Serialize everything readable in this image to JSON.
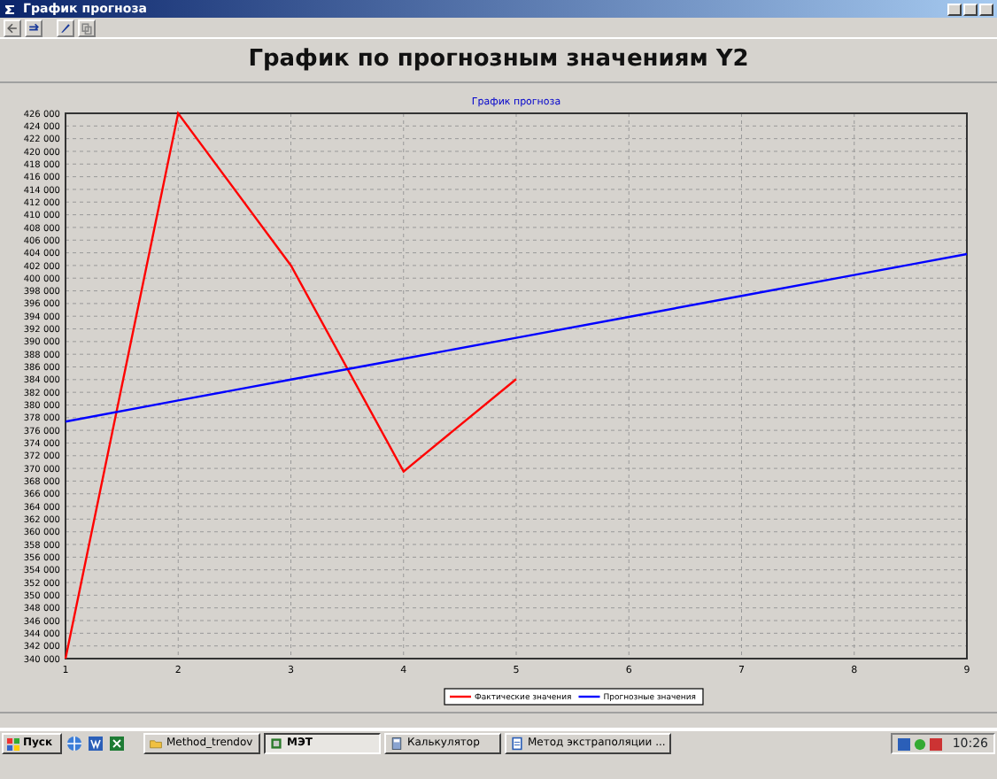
{
  "window": {
    "title": "График прогноза"
  },
  "toolbar": {
    "buttons": [
      {
        "kind": "back"
      },
      {
        "kind": "forward"
      },
      {
        "kind": "edit"
      },
      {
        "kind": "copy"
      }
    ]
  },
  "heading": "График по прогнозным значениям Y2",
  "chart_data": {
    "type": "line",
    "title": "График прогноза",
    "grid": true,
    "legend": true,
    "x": [
      1,
      2,
      3,
      4,
      5,
      6,
      7,
      8,
      9
    ],
    "xlim": [
      1,
      9
    ],
    "ylim": [
      340000,
      426000
    ],
    "xticks": [
      1,
      2,
      3,
      4,
      5,
      6,
      7,
      8,
      9
    ],
    "yticks": [
      {
        "value": 340000,
        "label": "340 000"
      },
      {
        "value": 342000,
        "label": "342 000"
      },
      {
        "value": 344000,
        "label": "344 000"
      },
      {
        "value": 346000,
        "label": "346 000"
      },
      {
        "value": 348000,
        "label": "348 000"
      },
      {
        "value": 350000,
        "label": "350 000"
      },
      {
        "value": 352000,
        "label": "352 000"
      },
      {
        "value": 354000,
        "label": "354 000"
      },
      {
        "value": 356000,
        "label": "356 000"
      },
      {
        "value": 358000,
        "label": "358 000"
      },
      {
        "value": 360000,
        "label": "360 000"
      },
      {
        "value": 362000,
        "label": "362 000"
      },
      {
        "value": 364000,
        "label": "364 000"
      },
      {
        "value": 366000,
        "label": "366 000"
      },
      {
        "value": 368000,
        "label": "368 000"
      },
      {
        "value": 370000,
        "label": "370 000"
      },
      {
        "value": 372000,
        "label": "372 000"
      },
      {
        "value": 374000,
        "label": "374 000"
      },
      {
        "value": 376000,
        "label": "376 000"
      },
      {
        "value": 378000,
        "label": "378 000"
      },
      {
        "value": 380000,
        "label": "380 000"
      },
      {
        "value": 382000,
        "label": "382 000"
      },
      {
        "value": 384000,
        "label": "384 000"
      },
      {
        "value": 386000,
        "label": "386 000"
      },
      {
        "value": 388000,
        "label": "388 000"
      },
      {
        "value": 390000,
        "label": "390 000"
      },
      {
        "value": 392000,
        "label": "392 000"
      },
      {
        "value": 394000,
        "label": "394 000"
      },
      {
        "value": 396000,
        "label": "396 000"
      },
      {
        "value": 398000,
        "label": "398 000"
      },
      {
        "value": 400000,
        "label": "400 000"
      },
      {
        "value": 402000,
        "label": "402 000"
      },
      {
        "value": 404000,
        "label": "404 000"
      },
      {
        "value": 406000,
        "label": "406 000"
      },
      {
        "value": 408000,
        "label": "408 000"
      },
      {
        "value": 410000,
        "label": "410 000"
      },
      {
        "value": 412000,
        "label": "412 000"
      },
      {
        "value": 414000,
        "label": "414 000"
      },
      {
        "value": 416000,
        "label": "416 000"
      },
      {
        "value": 418000,
        "label": "418 000"
      },
      {
        "value": 420000,
        "label": "420 000"
      },
      {
        "value": 422000,
        "label": "422 000"
      },
      {
        "value": 424000,
        "label": "424 000"
      },
      {
        "value": 426000,
        "label": "426 000"
      }
    ],
    "series": [
      {
        "name": "Фактические значения",
        "color": "#ff0000",
        "values": [
          340000,
          426000,
          402000,
          369500,
          384100,
          null,
          null,
          null,
          null
        ]
      },
      {
        "name": "Прогнозные значения",
        "color": "#0000ff",
        "values": [
          377400,
          380700,
          384000,
          387300,
          390600,
          393900,
          397200,
          400500,
          403800
        ]
      }
    ]
  },
  "taskbar": {
    "start": "Пуск",
    "quick_launch": [
      {
        "kind": "browser"
      },
      {
        "kind": "word"
      },
      {
        "kind": "excel"
      }
    ],
    "tasks": [
      {
        "label": "Method_trendov",
        "kind": "folder",
        "selected": false
      },
      {
        "label": "МЭТ",
        "kind": "app",
        "selected": true
      },
      {
        "label": "Калькулятор",
        "kind": "calc",
        "selected": false
      },
      {
        "label": "Метод экстраполяции ...",
        "kind": "doc",
        "selected": false
      }
    ],
    "clock": "10:26"
  }
}
